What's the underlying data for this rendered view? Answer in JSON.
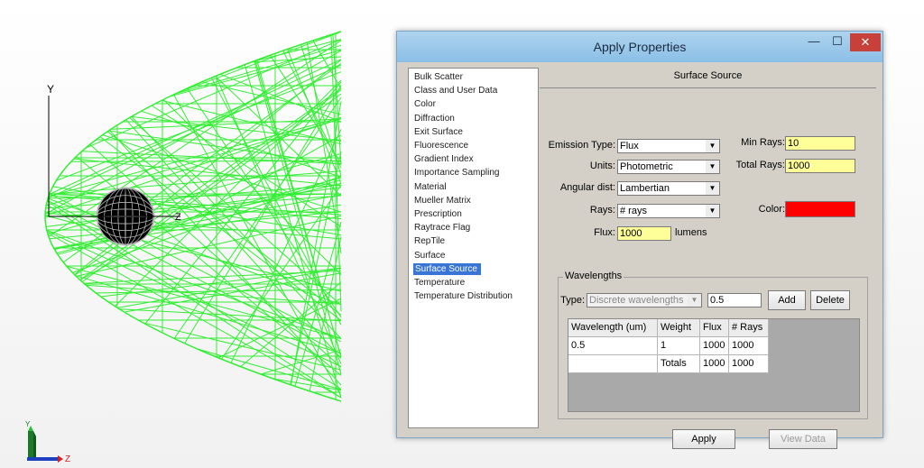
{
  "viewport": {
    "axis_y_label": "Y",
    "axis_z_label": "Z",
    "triad_y_label": "Y",
    "triad_z_label": "Z",
    "ray_color": "#33ee33"
  },
  "dialog": {
    "title": "Apply Properties",
    "close_glyph": "✕",
    "min_glyph": "—",
    "max_glyph": "☐",
    "properties": [
      "Bulk Scatter",
      "Class and User Data",
      "Color",
      "Diffraction",
      "Exit Surface",
      "Fluorescence",
      "Gradient Index",
      "Importance Sampling",
      "Material",
      "Mueller Matrix",
      "Prescription",
      "Raytrace Flag",
      "RepTile",
      "Surface",
      "Surface Source",
      "Temperature",
      "Temperature Distribution"
    ],
    "selected_property": "Surface Source",
    "panel_title": "Surface Source",
    "emission_type_label": "Emission Type:",
    "emission_type_value": "Flux",
    "units_label": "Units:",
    "units_value": "Photometric",
    "angular_dist_label": "Angular dist:",
    "angular_dist_value": "Lambertian",
    "rays_label": "Rays:",
    "rays_value": "# rays",
    "flux_label": "Flux:",
    "flux_value": "1000",
    "flux_unit": "lumens",
    "min_rays_label": "Min Rays:",
    "min_rays_value": "10",
    "total_rays_label": "Total Rays:",
    "total_rays_value": "1000",
    "color_label": "Color:",
    "color_value": "#ff0000",
    "wavelengths": {
      "group_label": "Wavelengths",
      "type_label": "Type:",
      "type_value": "Discrete wavelengths",
      "entry_value": "0.5",
      "add_label": "Add",
      "delete_label": "Delete",
      "columns": [
        "Wavelength (um)",
        "Weight",
        "Flux",
        "# Rays"
      ],
      "rows": [
        [
          "0.5",
          "1",
          "1000",
          "1000"
        ]
      ],
      "totals": [
        "",
        "Totals",
        "1000",
        "1000"
      ]
    },
    "apply_label": "Apply",
    "view_data_label": "View Data"
  }
}
